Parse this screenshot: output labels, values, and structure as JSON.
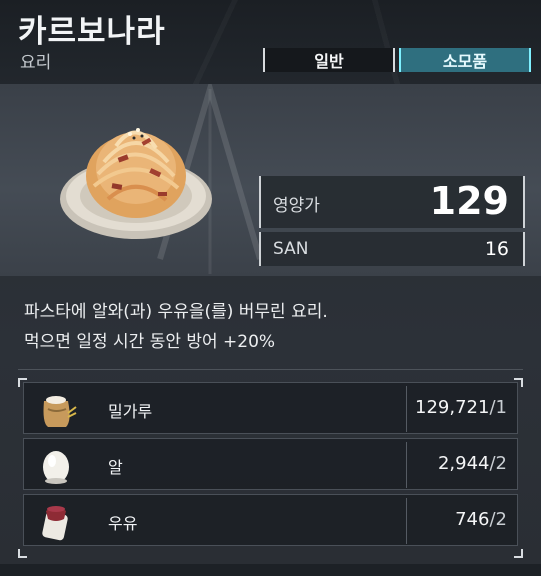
{
  "item": {
    "name": "카르보나라",
    "category": "요리"
  },
  "tabs": [
    {
      "label": "일반",
      "active": false
    },
    {
      "label": "소모품",
      "active": true
    }
  ],
  "stats": {
    "nutrition_label": "영양가",
    "nutrition_value": "129",
    "san_label": "SAN",
    "san_value": "16"
  },
  "description": {
    "line1": "파스타에 알와(과) 우유을(를) 버무린 요리.",
    "line2": "먹으면 일정 시간 동안 방어 +20%"
  },
  "ingredients": [
    {
      "name": "밀가루",
      "owned": "129,721",
      "required": "/1",
      "icon": "flour-sack-icon"
    },
    {
      "name": "알",
      "owned": "2,944",
      "required": "/2",
      "icon": "egg-icon"
    },
    {
      "name": "우유",
      "owned": "746",
      "required": "/2",
      "icon": "milk-bottle-icon"
    }
  ],
  "colors": {
    "active_tab": "#2f6f7f",
    "active_tab_border": "#7ff0ff",
    "panel_bg": "#2c3138"
  }
}
